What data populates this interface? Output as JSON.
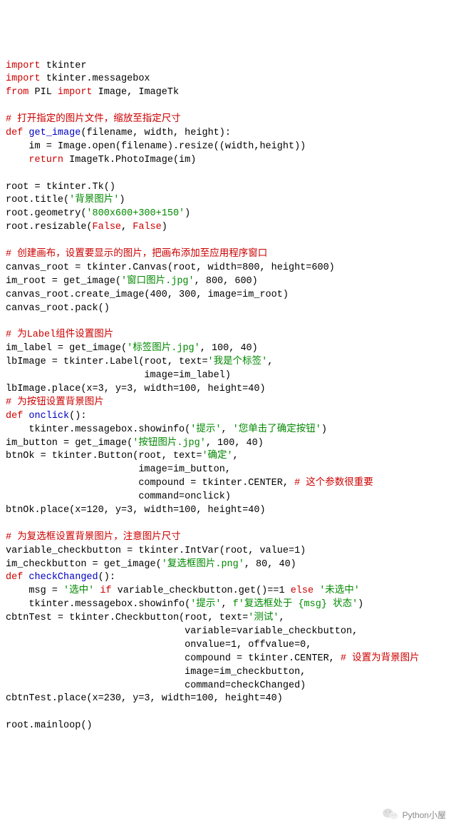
{
  "code": {
    "lines": [
      [
        {
          "t": "import",
          "c": "kw"
        },
        {
          "t": " tkinter"
        }
      ],
      [
        {
          "t": "import",
          "c": "kw"
        },
        {
          "t": " tkinter.messagebox"
        }
      ],
      [
        {
          "t": "from",
          "c": "kw"
        },
        {
          "t": " PIL "
        },
        {
          "t": "import",
          "c": "kw"
        },
        {
          "t": " Image, ImageTk"
        }
      ],
      [],
      [
        {
          "t": "# 打开指定的图片文件，缩放至指定尺寸",
          "c": "cmt"
        }
      ],
      [
        {
          "t": "def",
          "c": "kw"
        },
        {
          "t": " "
        },
        {
          "t": "get_image",
          "c": "fn"
        },
        {
          "t": "(filename, width, height):"
        }
      ],
      [
        {
          "t": "    im = Image.open(filename).resize((width,height))"
        }
      ],
      [
        {
          "t": "    "
        },
        {
          "t": "return",
          "c": "kw"
        },
        {
          "t": " ImageTk.PhotoImage(im)"
        }
      ],
      [],
      [
        {
          "t": "root = tkinter.Tk()"
        }
      ],
      [
        {
          "t": "root.title("
        },
        {
          "t": "'背景图片'",
          "c": "str"
        },
        {
          "t": ")"
        }
      ],
      [
        {
          "t": "root.geometry("
        },
        {
          "t": "'800x600+300+150'",
          "c": "str"
        },
        {
          "t": ")"
        }
      ],
      [
        {
          "t": "root.resizable("
        },
        {
          "t": "False",
          "c": "kw"
        },
        {
          "t": ", "
        },
        {
          "t": "False",
          "c": "kw"
        },
        {
          "t": ")"
        }
      ],
      [],
      [
        {
          "t": "# 创建画布，设置要显示的图片，把画布添加至应用程序窗口",
          "c": "cmt"
        }
      ],
      [
        {
          "t": "canvas_root = tkinter.Canvas(root, width=800, height=600)"
        }
      ],
      [
        {
          "t": "im_root = get_image("
        },
        {
          "t": "'窗口图片.jpg'",
          "c": "str"
        },
        {
          "t": ", 800, 600)"
        }
      ],
      [
        {
          "t": "canvas_root.create_image(400, 300, image=im_root)"
        }
      ],
      [
        {
          "t": "canvas_root.pack()"
        }
      ],
      [],
      [
        {
          "t": "# 为Label组件设置图片",
          "c": "cmt"
        }
      ],
      [
        {
          "t": "im_label = get_image("
        },
        {
          "t": "'标签图片.jpg'",
          "c": "str"
        },
        {
          "t": ", 100, 40)"
        }
      ],
      [
        {
          "t": "lbImage = tkinter.Label(root, text="
        },
        {
          "t": "'我是个标签'",
          "c": "str"
        },
        {
          "t": ","
        }
      ],
      [
        {
          "t": "                        image=im_label)"
        }
      ],
      [
        {
          "t": "lbImage.place(x=3, y=3, width=100, height=40)"
        }
      ],
      [
        {
          "t": "# 为按钮设置背景图片",
          "c": "cmt"
        }
      ],
      [
        {
          "t": "def",
          "c": "kw"
        },
        {
          "t": " "
        },
        {
          "t": "onclick",
          "c": "fn"
        },
        {
          "t": "():"
        }
      ],
      [
        {
          "t": "    tkinter.messagebox.showinfo("
        },
        {
          "t": "'提示'",
          "c": "str"
        },
        {
          "t": ", "
        },
        {
          "t": "'您单击了确定按钮'",
          "c": "str"
        },
        {
          "t": ")"
        }
      ],
      [
        {
          "t": "im_button = get_image("
        },
        {
          "t": "'按钮图片.jpg'",
          "c": "str"
        },
        {
          "t": ", 100, 40)"
        }
      ],
      [
        {
          "t": "btnOk = tkinter.Button(root, text="
        },
        {
          "t": "'确定'",
          "c": "str"
        },
        {
          "t": ","
        }
      ],
      [
        {
          "t": "                       image=im_button,"
        }
      ],
      [
        {
          "t": "                       compound = tkinter.CENTER, "
        },
        {
          "t": "# 这个参数很重要",
          "c": "cmt"
        }
      ],
      [
        {
          "t": "                       command=onclick)"
        }
      ],
      [
        {
          "t": "btnOk.place(x=120, y=3, width=100, height=40)"
        }
      ],
      [],
      [
        {
          "t": "# 为复选框设置背景图片，注意图片尺寸",
          "c": "cmt"
        }
      ],
      [
        {
          "t": "variable_checkbutton = tkinter.IntVar(root, value=1)"
        }
      ],
      [
        {
          "t": "im_checkbutton = get_image("
        },
        {
          "t": "'复选框图片.png'",
          "c": "str"
        },
        {
          "t": ", 80, 40)"
        }
      ],
      [
        {
          "t": "def",
          "c": "kw"
        },
        {
          "t": " "
        },
        {
          "t": "checkChanged",
          "c": "fn"
        },
        {
          "t": "():"
        }
      ],
      [
        {
          "t": "    msg = "
        },
        {
          "t": "'选中'",
          "c": "str"
        },
        {
          "t": " "
        },
        {
          "t": "if",
          "c": "kw"
        },
        {
          "t": " variable_checkbutton.get()==1 "
        },
        {
          "t": "else",
          "c": "kw"
        },
        {
          "t": " "
        },
        {
          "t": "'未选中'",
          "c": "str"
        }
      ],
      [
        {
          "t": "    tkinter.messagebox.showinfo("
        },
        {
          "t": "'提示'",
          "c": "str"
        },
        {
          "t": ", "
        },
        {
          "t": "f'复选框处于 {msg} 状态'",
          "c": "str"
        },
        {
          "t": ")"
        }
      ],
      [
        {
          "t": "cbtnTest = tkinter.Checkbutton(root, text="
        },
        {
          "t": "'测试'",
          "c": "str"
        },
        {
          "t": ","
        }
      ],
      [
        {
          "t": "                               variable=variable_checkbutton,"
        }
      ],
      [
        {
          "t": "                               onvalue=1, offvalue=0,"
        }
      ],
      [
        {
          "t": "                               compound = tkinter.CENTER, "
        },
        {
          "t": "# 设置为背景图片",
          "c": "cmt"
        }
      ],
      [
        {
          "t": "                               image=im_checkbutton,"
        }
      ],
      [
        {
          "t": "                               command=checkChanged)"
        }
      ],
      [
        {
          "t": "cbtnTest.place(x=230, y=3, width=100, height=40)"
        }
      ],
      [],
      [
        {
          "t": "root.mainloop()"
        }
      ]
    ]
  },
  "watermark": {
    "text": "Python小屋"
  }
}
